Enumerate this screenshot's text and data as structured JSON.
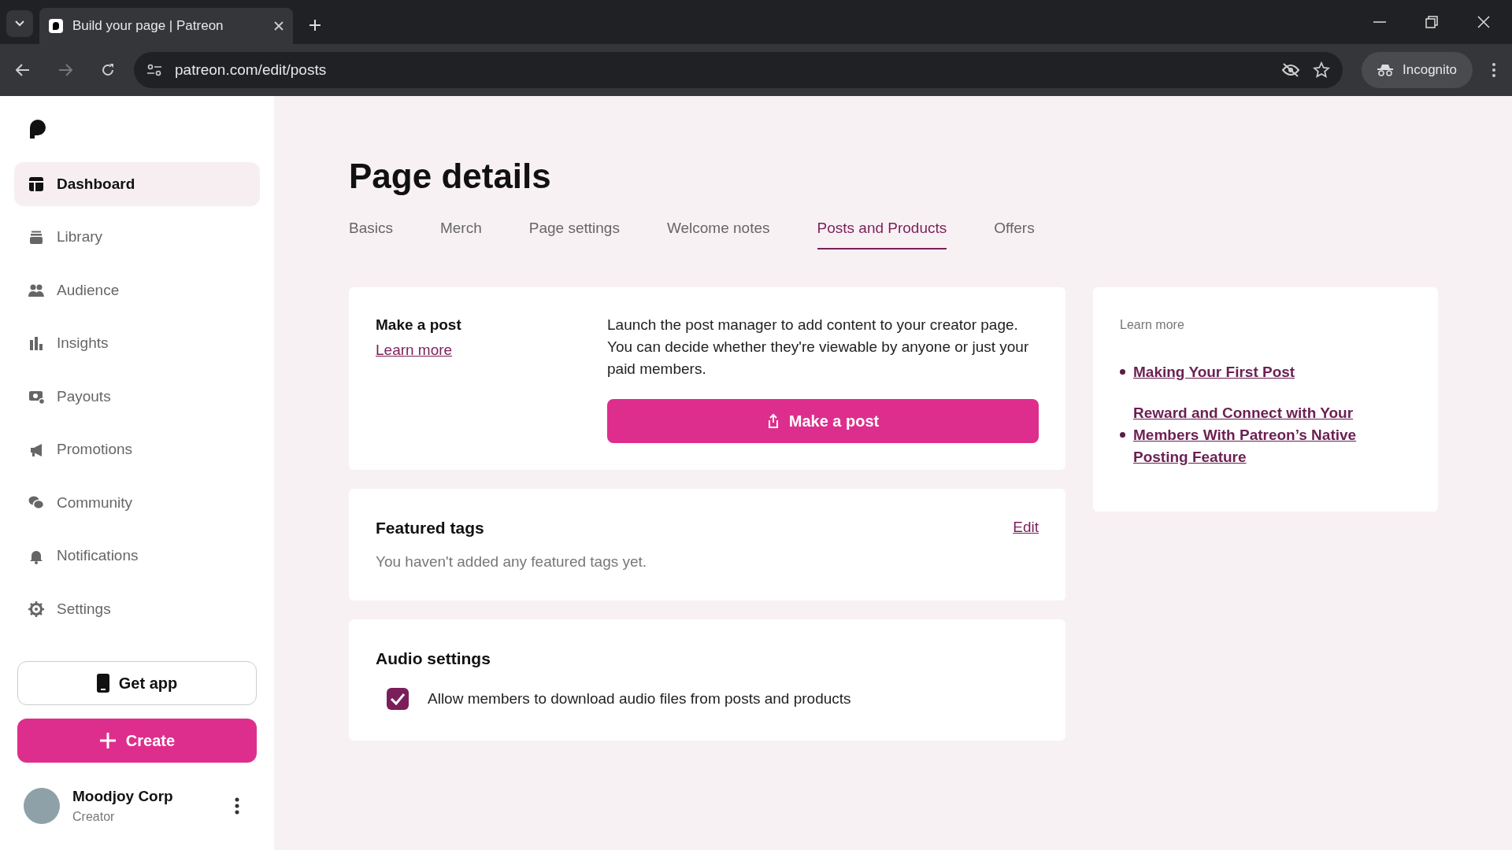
{
  "browser": {
    "tab_title": "Build your page | Patreon",
    "url": "patreon.com/edit/posts",
    "profile_label": "Incognito"
  },
  "sidebar": {
    "items": [
      {
        "label": "Dashboard",
        "selected": true
      },
      {
        "label": "Library",
        "selected": false
      },
      {
        "label": "Audience",
        "selected": false
      },
      {
        "label": "Insights",
        "selected": false
      },
      {
        "label": "Payouts",
        "selected": false
      },
      {
        "label": "Promotions",
        "selected": false
      },
      {
        "label": "Community",
        "selected": false
      },
      {
        "label": "Notifications",
        "selected": false
      },
      {
        "label": "Settings",
        "selected": false
      }
    ],
    "get_app": "Get app",
    "create": "Create",
    "profile": {
      "name": "Moodjoy Corp",
      "role": "Creator"
    }
  },
  "page": {
    "title": "Page details",
    "tabs": [
      {
        "label": "Basics",
        "selected": false
      },
      {
        "label": "Merch",
        "selected": false
      },
      {
        "label": "Page settings",
        "selected": false
      },
      {
        "label": "Welcome notes",
        "selected": false
      },
      {
        "label": "Posts and Products",
        "selected": true
      },
      {
        "label": "Offers",
        "selected": false
      }
    ],
    "make_post": {
      "title": "Make a post",
      "link": "Learn more",
      "description": "Launch the post manager to add content to your creator page. You can decide whether they're viewable by anyone or just your paid members.",
      "button": "Make a post"
    },
    "featured_tags": {
      "title": "Featured tags",
      "action": "Edit",
      "empty_text": "You haven't added any featured tags yet."
    },
    "audio_settings": {
      "title": "Audio settings",
      "option": {
        "label": "Allow members to download audio files from posts and products",
        "checked": true
      }
    },
    "learn_more": {
      "heading": "Learn more",
      "links": [
        "Making Your First Post",
        "Reward and Connect with Your Members With Patreon’s Native Posting Feature"
      ]
    }
  }
}
